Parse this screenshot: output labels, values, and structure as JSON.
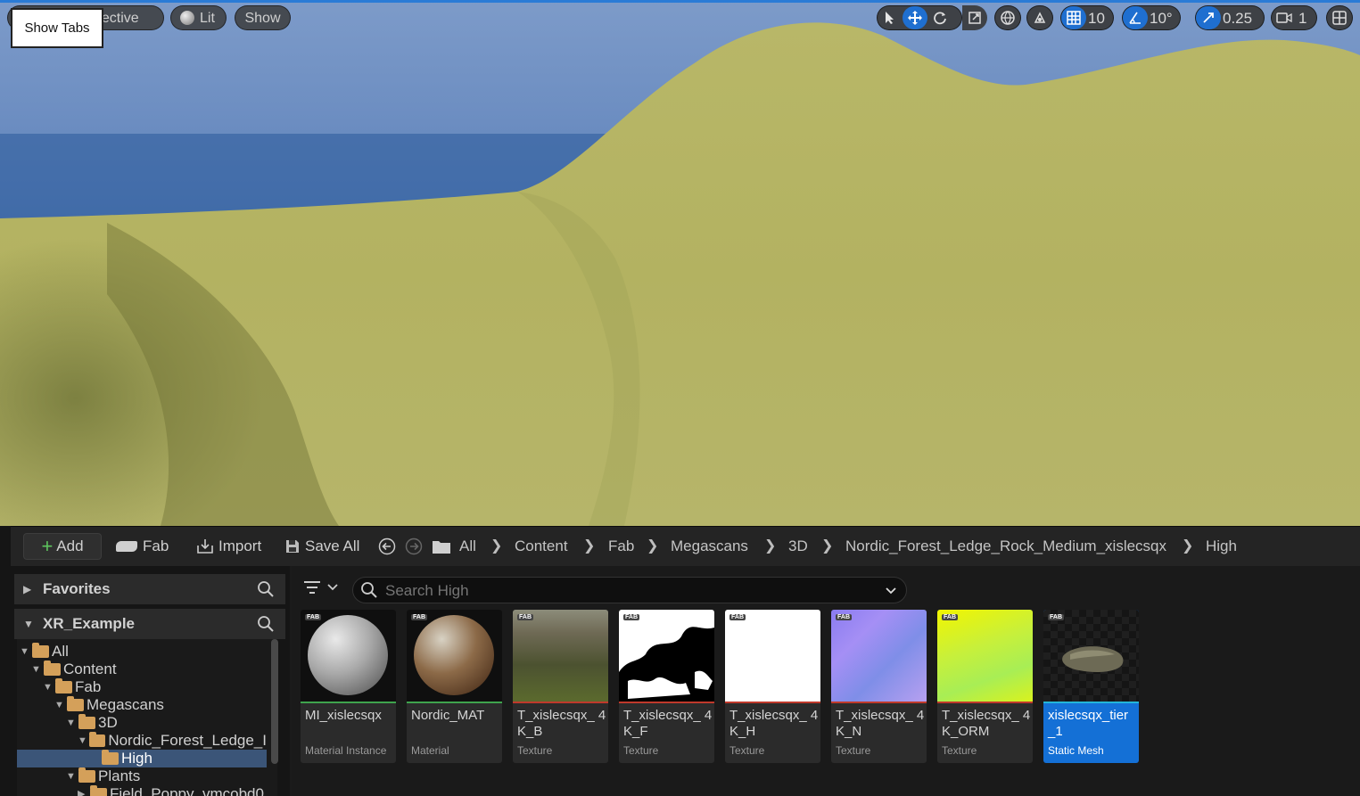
{
  "viewport": {
    "tooltip": "Show Tabs",
    "perspective_label": "Perspective",
    "lit_label": "Lit",
    "show_label": "Show",
    "grid_snap": "10",
    "rotation_snap": "10°",
    "scale_snap": "0.25",
    "camera_speed": "1"
  },
  "toolbar": {
    "add_label": "Add",
    "fab_label": "Fab",
    "import_label": "Import",
    "save_all_label": "Save All"
  },
  "breadcrumb": [
    "All",
    "Content",
    "Fab",
    "Megascans",
    "3D",
    "Nordic_Forest_Ledge_Rock_Medium_xislecsqx",
    "High"
  ],
  "sources": {
    "favorites_label": "Favorites",
    "project_label": "XR_Example",
    "tree": [
      {
        "label": "All"
      },
      {
        "label": "Content"
      },
      {
        "label": "Fab"
      },
      {
        "label": "Megascans"
      },
      {
        "label": "3D"
      },
      {
        "label": "Nordic_Forest_Ledge_I"
      },
      {
        "label": "High"
      },
      {
        "label": "Plants"
      },
      {
        "label": "Field_Poppy_vmcobd0"
      }
    ]
  },
  "search": {
    "placeholder": "Search High"
  },
  "assets": [
    {
      "name": "MI_xislecsqx",
      "type": "Material Instance",
      "accent": "#3fa34d"
    },
    {
      "name": "Nordic_MAT",
      "type": "Material",
      "accent": "#3fa34d"
    },
    {
      "name": "T_xislecsqx_ 4K_B",
      "type": "Texture",
      "accent": "#c0392b"
    },
    {
      "name": "T_xislecsqx_ 4K_F",
      "type": "Texture",
      "accent": "#c0392b"
    },
    {
      "name": "T_xislecsqx_ 4K_H",
      "type": "Texture",
      "accent": "#c0392b"
    },
    {
      "name": "T_xislecsqx_ 4K_N",
      "type": "Texture",
      "accent": "#c0392b"
    },
    {
      "name": "T_xislecsqx_ 4K_ORM",
      "type": "Texture",
      "accent": "#c0392b"
    },
    {
      "name": "xislecsqx_tier _1",
      "type": "Static Mesh",
      "accent": "#23b5d8"
    }
  ],
  "fab_badge": "FAB"
}
